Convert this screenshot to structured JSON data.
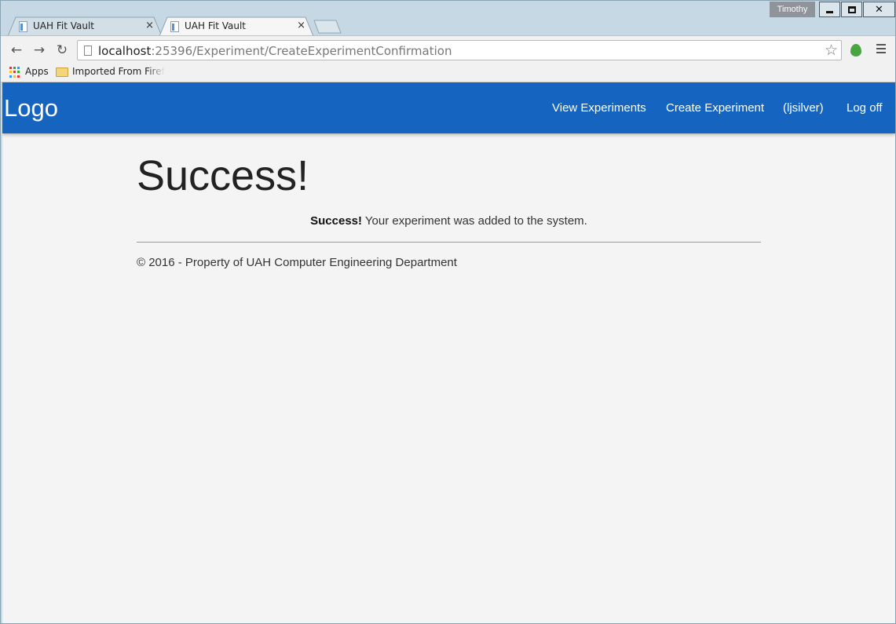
{
  "browser": {
    "user": "Timothy",
    "tabs": [
      {
        "title": "UAH Fit Vault",
        "close": "×",
        "active": false
      },
      {
        "title": "UAH Fit Vault",
        "close": "×",
        "active": true
      }
    ],
    "url_host": "localhost",
    "url_rest": ":25396/Experiment/CreateExperimentConfirmation",
    "bookmarks": {
      "apps": "Apps",
      "folder": "Imported From Firefox"
    },
    "icons": [
      "back-icon",
      "forward-icon",
      "reload-icon",
      "star-icon",
      "extension-icon",
      "menu-icon"
    ]
  },
  "navbar": {
    "logo": "Logo",
    "links": {
      "view": "View Experiments",
      "create": "Create Experiment",
      "user": "(ljsilver)",
      "logoff": "Log off"
    },
    "color": "#1565c0"
  },
  "main": {
    "title": "Success!",
    "message_strong": "Success!",
    "message_text": " Your experiment was added to the system.",
    "footer": "© 2016 - Property of UAH Computer Engineering Department"
  }
}
